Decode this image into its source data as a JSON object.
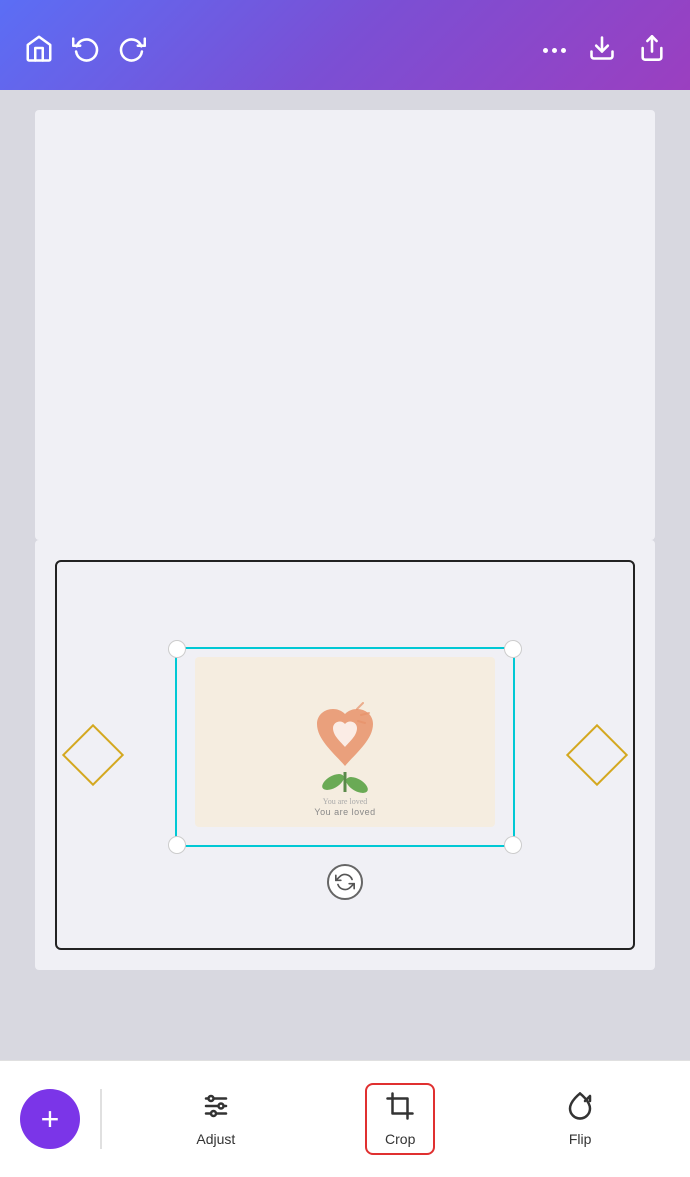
{
  "header": {
    "home_label": "Home",
    "undo_label": "Undo",
    "redo_label": "Redo",
    "more_label": "More options",
    "download_label": "Download",
    "share_label": "Share"
  },
  "canvas": {
    "card_text": "You are loved",
    "rotate_label": "Rotate"
  },
  "toolbar": {
    "add_label": "+",
    "adjust_label": "Adjust",
    "crop_label": "Crop",
    "flip_label": "Flip"
  }
}
